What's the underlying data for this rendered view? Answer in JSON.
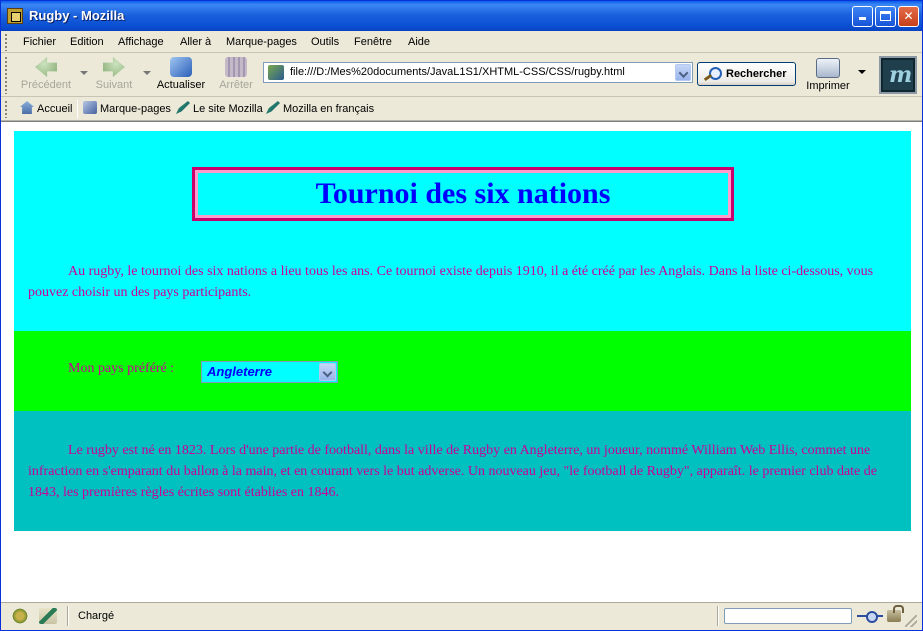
{
  "window": {
    "title": "Rugby - Mozilla",
    "controls": [
      "minimize",
      "maximize",
      "close"
    ]
  },
  "menubar": {
    "items": [
      "Fichier",
      "Edition",
      "Affichage",
      "Aller à",
      "Marque-pages",
      "Outils",
      "Fenêtre",
      "Aide"
    ]
  },
  "navbar": {
    "back_label": "Précédent",
    "forward_label": "Suivant",
    "reload_label": "Actualiser",
    "stop_label": "Arrêter",
    "url": "file:///D:/Mes%20documents/JavaL1S1/XHTML-CSS/CSS/rugby.html",
    "search_label": "Rechercher",
    "print_label": "Imprimer",
    "icons": {
      "back": "back-arrow-icon",
      "forward": "forward-arrow-icon",
      "reload": "reload-icon",
      "stop": "stop-icon",
      "search": "search-icon",
      "print": "printer-icon",
      "logo": "mozilla-logo"
    }
  },
  "personal_toolbar": {
    "items": [
      "Accueil",
      "Marque-pages",
      "Le site Mozilla",
      "Mozilla en français"
    ]
  },
  "page": {
    "title": "Tournoi des six nations",
    "intro": "Au rugby, le tournoi des six nations a lieu tous les ans. Ce tournoi existe depuis 1910, il a été créé par les Anglais. Dans la liste ci-dessous, vous pouvez choisir un des pays participants.",
    "country_label": "Mon pays préféré :",
    "country_selected": "Angleterre",
    "history": "Le rugby est né en 1823. Lors d'une partie de football, dans la ville de Rugby en Angleterre, un joueur, nommé William Web Ellis, commet une infraction en s'emparant du ballon à la main, et en courant vers le but adverse. Un nouveau jeu, \"le football de Rugby\", apparaît. le premier club date de 1843, les premières règles écrites sont établies en 1846.",
    "colors": {
      "section_top": "#00ffff",
      "section_middle": "#00ff00",
      "section_bottom": "#00c0c0",
      "title_text": "#0000ff",
      "title_border": "#c9006b",
      "body_text": "#cc0099"
    }
  },
  "statusbar": {
    "text": "Chargé"
  }
}
